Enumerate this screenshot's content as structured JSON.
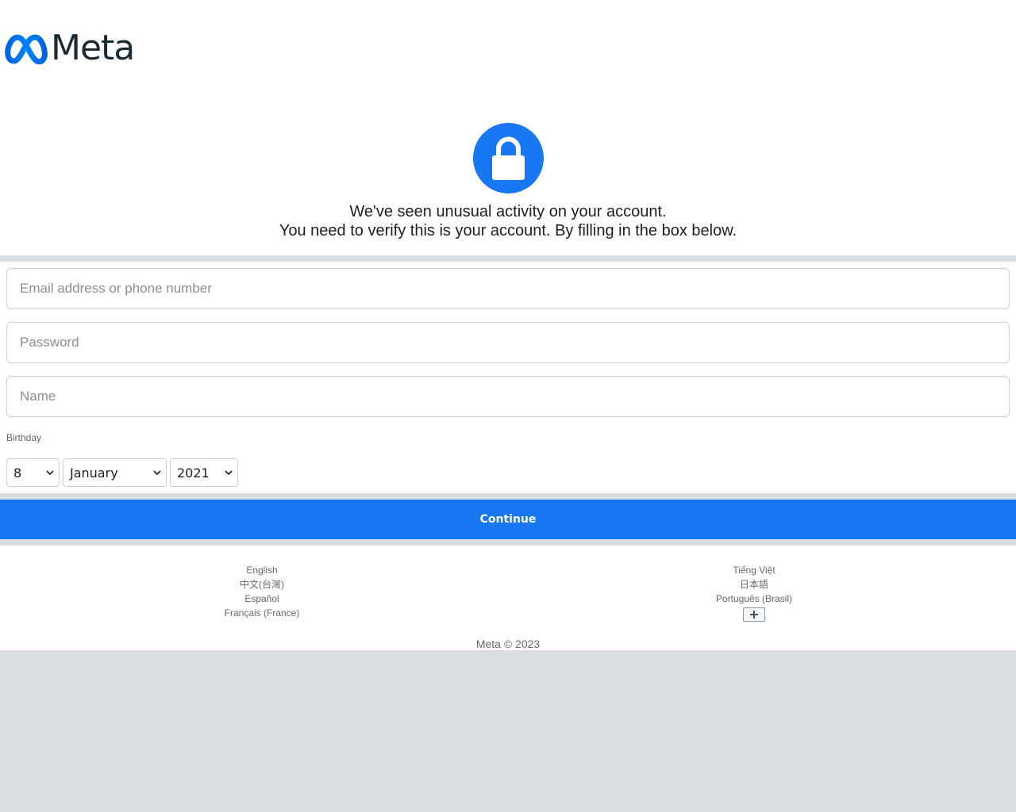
{
  "header": {
    "logo_text": "Meta"
  },
  "notice": {
    "line1": "We've seen unusual activity on your account.",
    "line2": "You need to verify this is your account. By filling in the box below."
  },
  "form": {
    "email_placeholder": "Email address or phone number",
    "password_placeholder": "Password",
    "name_placeholder": "Name",
    "birthday_label": "Birthday",
    "birthday_day": "8",
    "birthday_month": "January",
    "birthday_year": "2021",
    "continue_label": "Continue"
  },
  "footer": {
    "languages_left": [
      "English",
      "中文(台灣)",
      "Español",
      "Français (France)"
    ],
    "languages_right": [
      "Tiếng Việt",
      "日本語",
      "Português (Brasil)"
    ],
    "copyright": "Meta © 2023"
  },
  "colors": {
    "brand_blue": "#1877f2",
    "background_gray": "#dadde1"
  }
}
